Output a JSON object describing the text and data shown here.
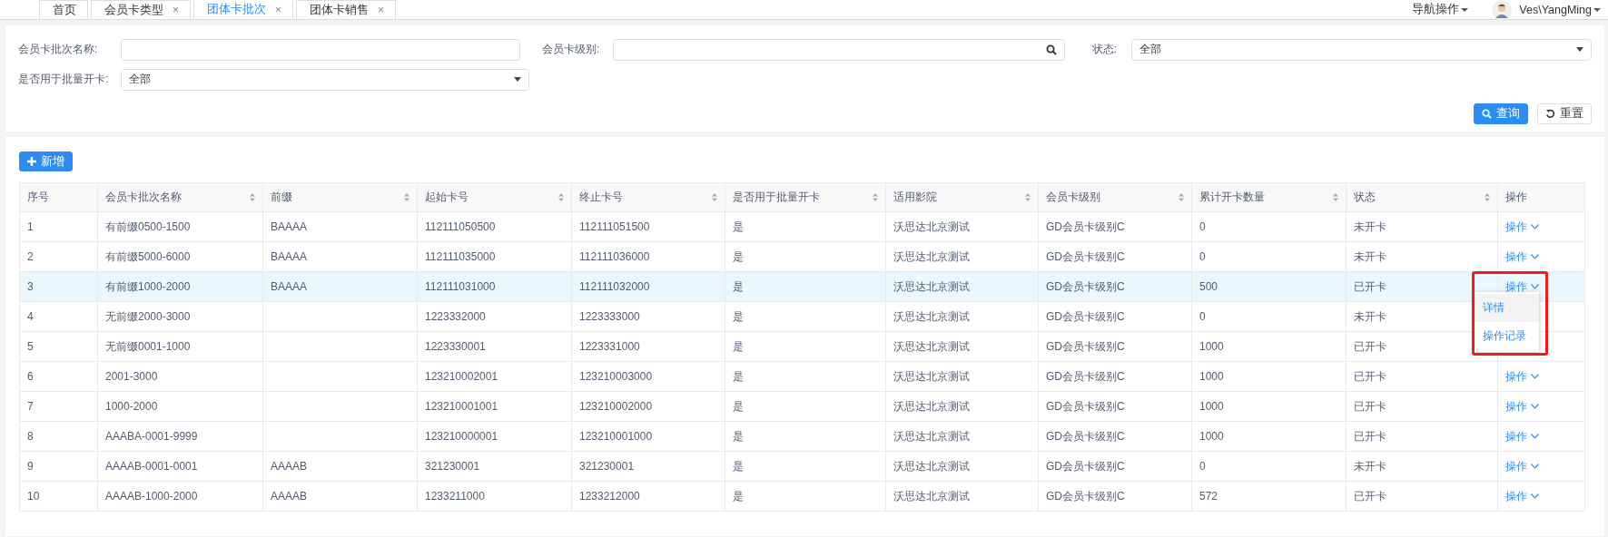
{
  "tabs": [
    {
      "label": "首页",
      "selected": false
    },
    {
      "label": "会员卡类型",
      "selected": false,
      "close": "×"
    },
    {
      "label": "团体卡批次",
      "selected": true,
      "close": "×"
    },
    {
      "label": "团体卡销售",
      "selected": false,
      "close": "×"
    }
  ],
  "header": {
    "nav_menu": "导航操作",
    "user": "Ves\\YangMing"
  },
  "filters": {
    "batch_name": {
      "label": "会员卡批次名称:"
    },
    "card_level": {
      "label": "会员卡级别:"
    },
    "status": {
      "label": "状态:",
      "value": "全部"
    },
    "batch_open": {
      "label": "是否用于批量开卡:",
      "value": "全部"
    },
    "query_button": "查询",
    "reset_button": "重置"
  },
  "add_button": "新增",
  "table": {
    "columns": [
      {
        "label": "序号",
        "sortable": false
      },
      {
        "label": "会员卡批次名称",
        "sortable": true
      },
      {
        "label": "前缀",
        "sortable": true
      },
      {
        "label": "起始卡号",
        "sortable": true
      },
      {
        "label": "终止卡号",
        "sortable": true
      },
      {
        "label": "是否用于批量开卡",
        "sortable": true
      },
      {
        "label": "适用影院",
        "sortable": true
      },
      {
        "label": "会员卡级别",
        "sortable": true
      },
      {
        "label": "累计开卡数量",
        "sortable": true
      },
      {
        "label": "状态",
        "sortable": true
      },
      {
        "label": "操作",
        "sortable": false
      }
    ],
    "rows": [
      {
        "cells": [
          "1",
          "有前缀0500-1500",
          "BAAAA",
          "112111050500",
          "112111051500",
          "是",
          "沃思达北京测试",
          "GD会员卡级别C",
          "0",
          "未开卡"
        ],
        "action": "操作",
        "selected": false,
        "menu_open": false
      },
      {
        "cells": [
          "2",
          "有前缀5000-6000",
          "BAAAA",
          "112111035000",
          "112111036000",
          "是",
          "沃思达北京测试",
          "GD会员卡级别C",
          "0",
          "未开卡"
        ],
        "action": "操作",
        "selected": false,
        "menu_open": false
      },
      {
        "cells": [
          "3",
          "有前缀1000-2000",
          "BAAAA",
          "112111031000",
          "112111032000",
          "是",
          "沃思达北京测试",
          "GD会员卡级别C",
          "500",
          "已开卡"
        ],
        "action": "操作",
        "selected": true,
        "menu_open": true
      },
      {
        "cells": [
          "4",
          "无前缀2000-3000",
          null,
          "1223332000",
          "1223333000",
          "是",
          "沃思达北京测试",
          "GD会员卡级别C",
          "0",
          "未开卡"
        ],
        "selected": false,
        "menu_open": false
      },
      {
        "cells": [
          "5",
          "无前缀0001-1000",
          null,
          "1223330001",
          "1223331000",
          "是",
          "沃思达北京测试",
          "GD会员卡级别C",
          "1000",
          "已开卡"
        ],
        "selected": false,
        "menu_open": false
      },
      {
        "cells": [
          "6",
          "2001-3000",
          null,
          "123210002001",
          "123210003000",
          "是",
          "沃思达北京测试",
          "GD会员卡级别C",
          "1000",
          "已开卡"
        ],
        "action": "操作",
        "selected": false,
        "menu_open": false
      },
      {
        "cells": [
          "7",
          "1000-2000",
          null,
          "123210001001",
          "123210002000",
          "是",
          "沃思达北京测试",
          "GD会员卡级别C",
          "1000",
          "已开卡"
        ],
        "action": "操作",
        "selected": false,
        "menu_open": false
      },
      {
        "cells": [
          "8",
          "AAABA-0001-9999",
          null,
          "123210000001",
          "123210001000",
          "是",
          "沃思达北京测试",
          "GD会员卡级别C",
          "1000",
          "已开卡"
        ],
        "action": "操作",
        "selected": false,
        "menu_open": false
      },
      {
        "cells": [
          "9",
          "AAAAB-0001-0001",
          "AAAAB",
          "321230001",
          "321230001",
          "是",
          "沃思达北京测试",
          "GD会员卡级别C",
          "0",
          "未开卡"
        ],
        "action": "操作",
        "selected": false,
        "menu_open": false
      },
      {
        "cells": [
          "10",
          "AAAAB-1000-2000",
          "AAAAB",
          "1233211000",
          "1233212000",
          "是",
          "沃思达北京测试",
          "GD会员卡级别C",
          "572",
          "已开卡"
        ],
        "action": "操作",
        "selected": false,
        "menu_open": false
      }
    ]
  },
  "action_menu": {
    "highlight_frame": true,
    "items": [
      {
        "label": "详情",
        "hovered": true
      },
      {
        "label": "操作记录",
        "hovered": false
      }
    ]
  }
}
